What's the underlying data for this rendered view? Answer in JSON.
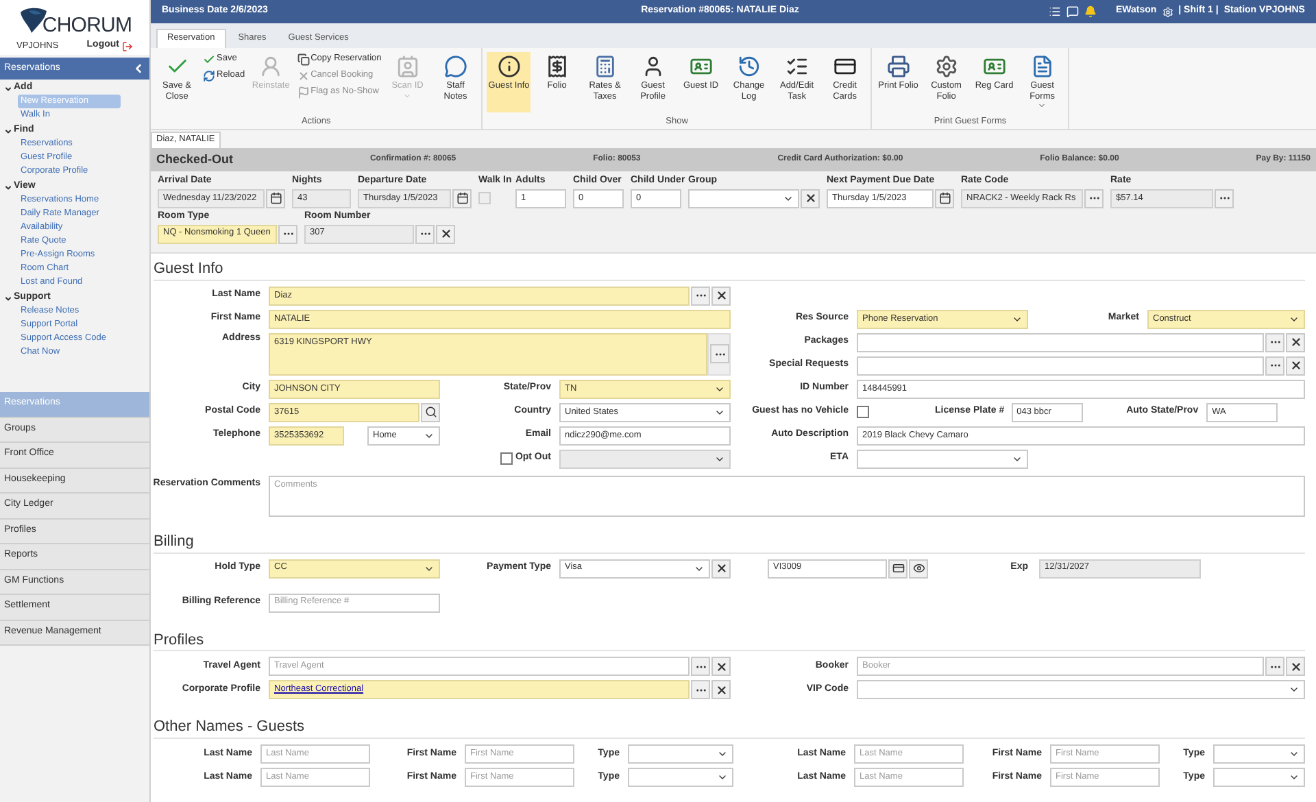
{
  "app": {
    "brand": "CHORUM",
    "user": "VPJOHNS",
    "logout": "Logout"
  },
  "sidebar": {
    "title": "Reservations",
    "groups": [
      {
        "label": "Add",
        "expanded": true,
        "items": [
          {
            "label": "New Reservation",
            "selected": true
          },
          {
            "label": "Walk In",
            "selected": false
          }
        ]
      },
      {
        "label": "Find",
        "expanded": true,
        "items": [
          {
            "label": "Reservations",
            "selected": false
          },
          {
            "label": "Guest Profile",
            "selected": false
          },
          {
            "label": "Corporate Profile",
            "selected": false
          }
        ]
      },
      {
        "label": "View",
        "expanded": true,
        "items": [
          {
            "label": "Reservations Home",
            "selected": false
          },
          {
            "label": "Daily Rate Manager",
            "selected": false
          },
          {
            "label": "Availability",
            "selected": false
          },
          {
            "label": "Rate Quote",
            "selected": false
          },
          {
            "label": "Pre-Assign Rooms",
            "selected": false
          },
          {
            "label": "Room Chart",
            "selected": false
          },
          {
            "label": "Lost and Found",
            "selected": false
          }
        ]
      },
      {
        "label": "Support",
        "expanded": true,
        "items": [
          {
            "label": "Release Notes",
            "selected": false
          },
          {
            "label": "Support Portal",
            "selected": false
          },
          {
            "label": "Support Access Code",
            "selected": false
          },
          {
            "label": "Chat Now",
            "selected": false
          }
        ]
      }
    ]
  },
  "modules": [
    {
      "label": "Reservations",
      "selected": true
    },
    {
      "label": "Groups",
      "selected": false
    },
    {
      "label": "Front Office",
      "selected": false
    },
    {
      "label": "Housekeeping",
      "selected": false
    },
    {
      "label": "City Ledger",
      "selected": false
    },
    {
      "label": "Profiles",
      "selected": false
    },
    {
      "label": "Reports",
      "selected": false
    },
    {
      "label": "GM Functions",
      "selected": false
    },
    {
      "label": "Settlement",
      "selected": false
    },
    {
      "label": "Revenue Management",
      "selected": false
    }
  ],
  "header": {
    "business_date": "Business Date 2/6/2023",
    "title": "Reservation #80065: NATALIE Diaz",
    "user": "EWatson",
    "shift": "| Shift 1 |",
    "station": "Station VPJOHNS"
  },
  "ribbon": {
    "tabs": [
      {
        "label": "Reservation",
        "selected": true
      },
      {
        "label": "Shares",
        "selected": false
      },
      {
        "label": "Guest Services",
        "selected": false
      }
    ],
    "groups": [
      {
        "label": "Actions",
        "buttons": [
          {
            "kind": "large",
            "label": "Save & Close",
            "disabled": false,
            "selected": false
          },
          {
            "kind": "stack",
            "buttons": [
              {
                "label": "Save",
                "disabled": false
              },
              {
                "label": "Reload",
                "disabled": false
              }
            ]
          },
          {
            "kind": "large",
            "label": "Reinstate",
            "disabled": true,
            "selected": false
          },
          {
            "kind": "stack",
            "buttons": [
              {
                "label": "Copy Reservation",
                "disabled": false
              },
              {
                "label": "Cancel Booking",
                "disabled": true
              },
              {
                "label": "Flag as No-Show",
                "disabled": true
              }
            ]
          },
          {
            "kind": "large",
            "label": "Scan ID",
            "disabled": true,
            "selected": false,
            "dropdown": true
          },
          {
            "kind": "large",
            "label": "Staff Notes",
            "disabled": false,
            "selected": false
          }
        ]
      },
      {
        "label": "Show",
        "buttons": [
          {
            "kind": "large",
            "label": "Guest Info",
            "disabled": false,
            "selected": true
          },
          {
            "kind": "large",
            "label": "Folio",
            "disabled": false,
            "selected": false
          },
          {
            "kind": "large",
            "label": "Rates & Taxes",
            "disabled": false,
            "selected": false
          },
          {
            "kind": "large",
            "label": "Guest Profile",
            "disabled": false,
            "selected": false
          },
          {
            "kind": "large",
            "label": "Guest ID",
            "disabled": false,
            "selected": false
          },
          {
            "kind": "large",
            "label": "Change Log",
            "disabled": false,
            "selected": false
          },
          {
            "kind": "large",
            "label": "Add/Edit Task",
            "disabled": false,
            "selected": false
          },
          {
            "kind": "large",
            "label": "Credit Cards",
            "disabled": false,
            "selected": false
          }
        ]
      },
      {
        "label": "Print Guest Forms",
        "buttons": [
          {
            "kind": "large",
            "label": "Print Folio",
            "disabled": false,
            "selected": false
          },
          {
            "kind": "large",
            "label": "Custom Folio",
            "disabled": false,
            "selected": false
          },
          {
            "kind": "large",
            "label": "Reg Card",
            "disabled": false,
            "selected": false
          },
          {
            "kind": "large",
            "label": "Guest Forms",
            "disabled": false,
            "selected": false,
            "dropdown": true
          }
        ]
      }
    ]
  },
  "document_tab": "Diaz, NATALIE",
  "status": {
    "state": "Checked-Out",
    "items": [
      "Confirmation #: 80065",
      "Folio: 80053",
      "Credit Card Authorization: $0.00",
      "Folio Balance: $0.00",
      "Pay By: 11150"
    ]
  },
  "stay": {
    "rows": [
      [
        {
          "label": "Arrival Date",
          "kind": "date",
          "value": "Wednesday 11/23/2022",
          "disabled": true
        },
        {
          "label": "Nights",
          "kind": "text",
          "value": "43",
          "disabled": true
        },
        {
          "label": "Departure Date",
          "kind": "date",
          "value": "Thursday 1/5/2023",
          "disabled": true
        },
        {
          "label": "Walk In",
          "kind": "checkbox",
          "checked": false,
          "disabled": true
        },
        {
          "label": "Adults",
          "kind": "text",
          "value": "1"
        },
        {
          "label": "Child Over",
          "kind": "text",
          "value": "0"
        },
        {
          "label": "Child Under",
          "kind": "text",
          "value": "0"
        },
        {
          "label": "Group",
          "kind": "select",
          "clear": true
        },
        {
          "label": "Next Payment Due Date",
          "kind": "date",
          "value": "Thursday 1/5/2023"
        },
        {
          "label": "Rate Code",
          "kind": "text",
          "value": "NRACK2 - Weekly Rack Rs",
          "disabled": true,
          "more": true
        },
        {
          "label": "Rate",
          "kind": "text",
          "value": "$57.14",
          "disabled": true,
          "more": true
        }
      ],
      [
        {
          "label": "Room Type",
          "kind": "text",
          "value": "NQ - Nonsmoking 1 Queen",
          "required": true,
          "more": true
        },
        {
          "label": "Room Number",
          "kind": "text",
          "value": "307",
          "disabled": true,
          "more": true,
          "clear": true
        }
      ]
    ]
  },
  "guest_info": {
    "title": "Guest Info",
    "last_name": {
      "label": "Last Name",
      "kind": "text",
      "value": "Diaz",
      "required": true,
      "more": true,
      "clear": true
    },
    "first_name": {
      "label": "First Name",
      "kind": "text",
      "value": "NATALIE",
      "required": true
    },
    "res_source": {
      "label": "Res Source",
      "kind": "select",
      "value": "Phone Reservation",
      "required": true
    },
    "market": {
      "label": "Market",
      "kind": "select",
      "value": "Construct",
      "required": true
    },
    "address": {
      "label": "Address",
      "kind": "textarea",
      "value": "6319 KINGSPORT HWY",
      "required": true,
      "more": true
    },
    "packages": {
      "label": "Packages",
      "kind": "text",
      "more": true,
      "clear": true
    },
    "special_requests": {
      "label": "Special Requests",
      "kind": "text",
      "more": true,
      "clear": true
    },
    "city": {
      "label": "City",
      "kind": "text",
      "value": "JOHNSON CITY",
      "required": true
    },
    "state": {
      "label": "State/Prov",
      "kind": "select",
      "value": "TN",
      "required": true
    },
    "id_number": {
      "label": "ID Number",
      "kind": "text",
      "value": "148445991"
    },
    "postal_code": {
      "label": "Postal Code",
      "kind": "text",
      "value": "37615",
      "required": true,
      "search": true
    },
    "country": {
      "label": "Country",
      "kind": "select",
      "value": "United States"
    },
    "no_vehicle": {
      "label": "Guest has no Vehicle",
      "kind": "checkbox",
      "checked": false
    },
    "license_plate": {
      "label": "License Plate #",
      "kind": "text",
      "value": "043 bbcr"
    },
    "auto_state": {
      "label": "Auto State/Prov",
      "kind": "text",
      "value": "WA"
    },
    "telephone": {
      "label": "Telephone",
      "kind": "text",
      "value": "3525353692",
      "required": true
    },
    "phone_type": {
      "kind": "select",
      "value": "Home"
    },
    "email": {
      "label": "Email",
      "kind": "text",
      "value": "ndicz290@me.com"
    },
    "auto_description": {
      "label": "Auto Description",
      "kind": "text",
      "value": "2019 Black Chevy Camaro"
    },
    "opt_out": {
      "label": "Opt Out",
      "kind": "checkbox",
      "checked": false
    },
    "opt_out_select": {
      "kind": "select",
      "disabled": true
    },
    "eta": {
      "label": "ETA",
      "kind": "select"
    },
    "comments": {
      "label": "Reservation Comments",
      "kind": "textarea",
      "placeholder": "Comments"
    }
  },
  "billing": {
    "title": "Billing",
    "hold_type": {
      "label": "Hold Type",
      "kind": "select",
      "value": "CC",
      "required": true
    },
    "payment_type": {
      "label": "Payment Type",
      "kind": "select",
      "value": "Visa",
      "clear": true
    },
    "card": {
      "kind": "card",
      "value": "VI3009"
    },
    "exp": {
      "label": "Exp",
      "kind": "text",
      "value": "12/31/2027",
      "disabled": true
    },
    "billing_reference": {
      "label": "Billing Reference",
      "kind": "text",
      "placeholder": "Billing Reference #"
    }
  },
  "profiles": {
    "title": "Profiles",
    "travel_agent": {
      "label": "Travel Agent",
      "kind": "text",
      "placeholder": "Travel Agent",
      "more": true,
      "clear": true
    },
    "booker": {
      "label": "Booker",
      "kind": "text",
      "placeholder": "Booker",
      "more": true,
      "clear": true
    },
    "corporate_profile": {
      "label": "Corporate Profile",
      "kind": "text",
      "value": "Northeast Correctional",
      "link": true,
      "required": true,
      "more": true,
      "clear": true
    },
    "vip_code": {
      "label": "VIP Code",
      "kind": "select"
    }
  },
  "other_names": {
    "title": "Other Names - Guests",
    "rows": [
      [
        {
          "label": "Last Name",
          "kind": "text",
          "placeholder": "Last Name"
        },
        {
          "label": "First Name",
          "kind": "text",
          "placeholder": "First Name"
        },
        {
          "label": "Type",
          "kind": "select"
        },
        {
          "label": "Last Name",
          "kind": "text",
          "placeholder": "Last Name"
        },
        {
          "label": "First Name",
          "kind": "text",
          "placeholder": "First Name"
        },
        {
          "label": "Type",
          "kind": "select"
        }
      ],
      [
        {
          "label": "Last Name",
          "kind": "text",
          "placeholder": "Last Name"
        },
        {
          "label": "First Name",
          "kind": "text",
          "placeholder": "First Name"
        },
        {
          "label": "Type",
          "kind": "select"
        },
        {
          "label": "Last Name",
          "kind": "text",
          "placeholder": "Last Name"
        },
        {
          "label": "First Name",
          "kind": "text",
          "placeholder": "First Name"
        },
        {
          "label": "Type",
          "kind": "select"
        }
      ]
    ]
  }
}
